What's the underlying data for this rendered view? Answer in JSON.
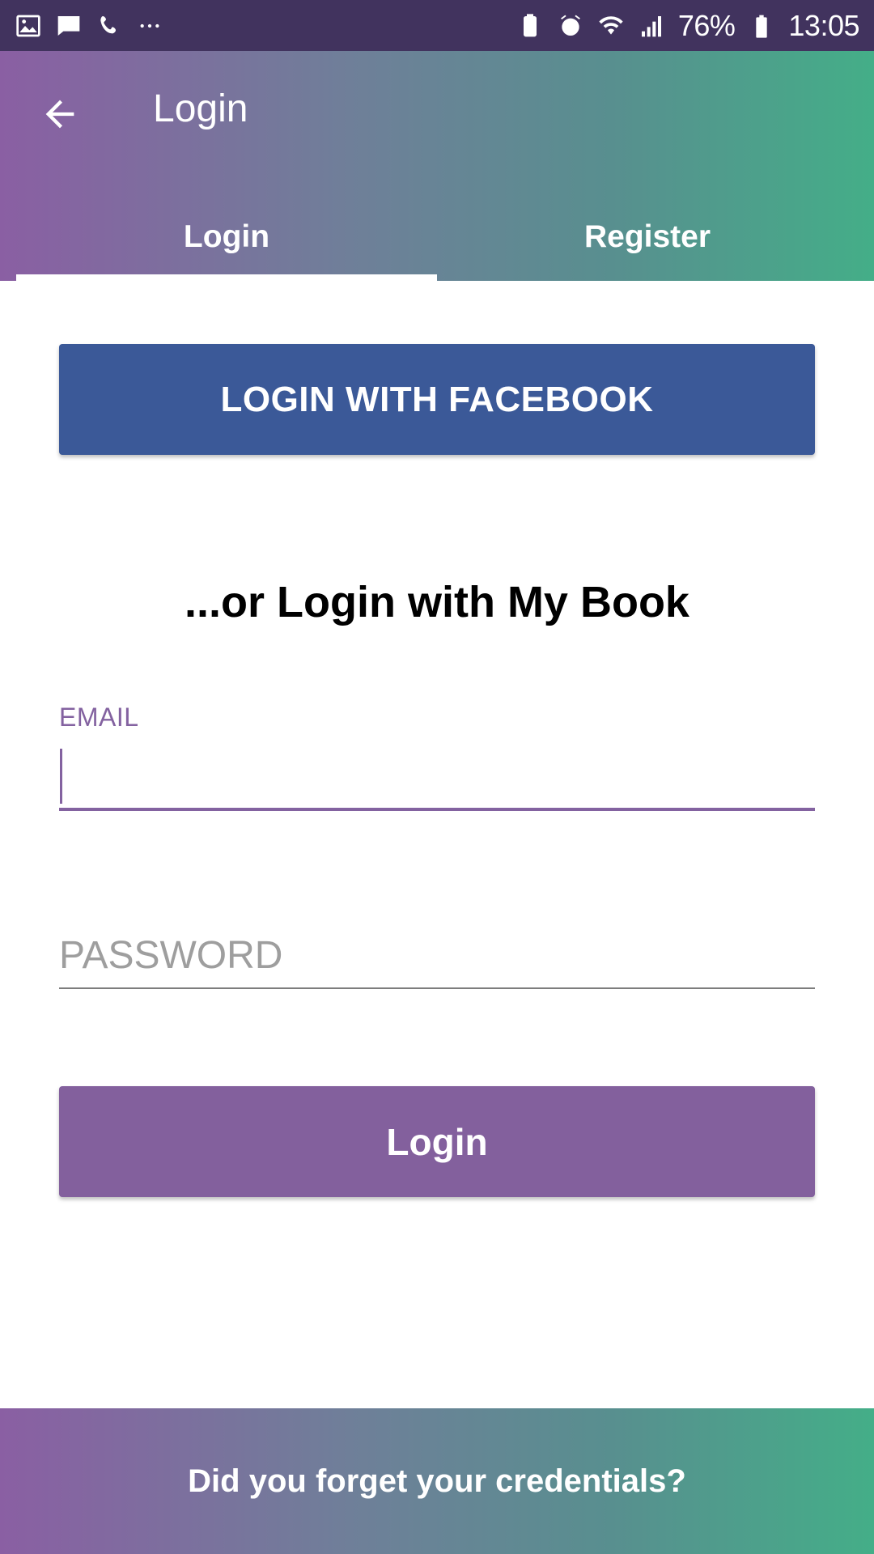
{
  "status_bar": {
    "left_icons": [
      "gallery-icon",
      "message-icon",
      "call-icon",
      "more-dots-icon"
    ],
    "right_icons": [
      "battery-saver-icon",
      "alarm-icon",
      "wifi-icon",
      "signal-icon"
    ],
    "battery": "76%",
    "time": "13:05"
  },
  "app_bar": {
    "title": "Login",
    "tabs": [
      {
        "label": "Login",
        "active": true
      },
      {
        "label": "Register",
        "active": false
      }
    ]
  },
  "main": {
    "facebook_button": "LOGIN WITH FACEBOOK",
    "or_text": "...or Login with My Book",
    "email_label": "EMAIL",
    "email_value": "",
    "password_placeholder": "PASSWORD",
    "login_button": "Login"
  },
  "footer": {
    "forgot_text": "Did you forget your credentials?"
  },
  "colors": {
    "status_bar": "#41335e",
    "gradient_start": "#8a5fa3",
    "gradient_end": "#44ae88",
    "facebook": "#3b5998",
    "accent": "#83609d"
  }
}
